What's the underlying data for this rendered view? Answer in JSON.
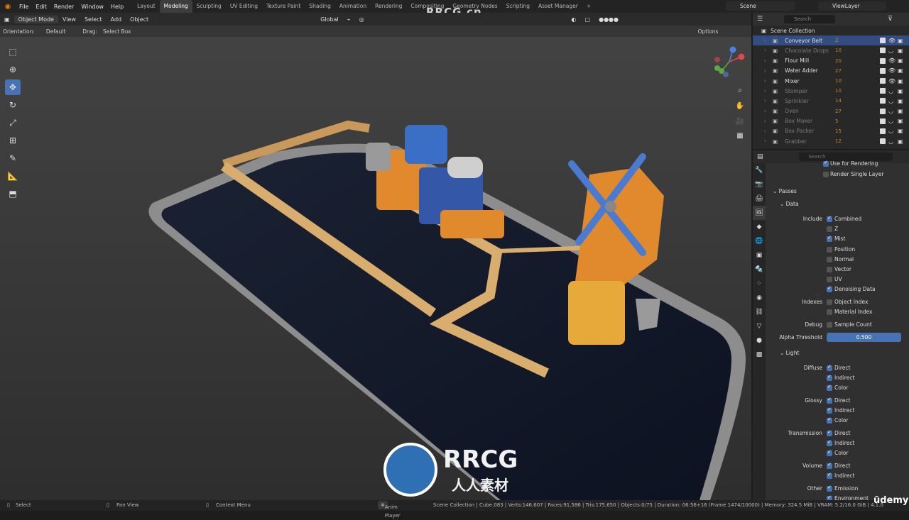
{
  "app": {
    "menus": [
      "File",
      "Edit",
      "Render",
      "Window",
      "Help"
    ],
    "workspaces": [
      "Layout",
      "Modeling",
      "Sculpting",
      "UV Editing",
      "Texture Paint",
      "Shading",
      "Animation",
      "Rendering",
      "Compositing",
      "Geometry Nodes",
      "Scripting",
      "Asset Manager"
    ],
    "active_workspace": "Modeling",
    "scene": "Scene",
    "view_layer": "ViewLayer",
    "watermark": "RRCG.cn"
  },
  "viewport_header": {
    "mode": "Object Mode",
    "menus": [
      "View",
      "Select",
      "Add",
      "Object"
    ],
    "transform": "Global",
    "orientation_label": "Orientation:",
    "orientation_value": "Default",
    "drag_label": "Drag:",
    "drag_value": "Select Box",
    "options": "Options"
  },
  "outliner": {
    "search_placeholder": "Search",
    "root": "Scene Collection",
    "items": [
      {
        "name": "Conveyor Belt",
        "badge": "2",
        "selected": true,
        "dim": false,
        "visible": true
      },
      {
        "name": "Chocolate Drops",
        "badge": "10",
        "selected": false,
        "dim": true,
        "visible": false
      },
      {
        "name": "Flour Mill",
        "badge": "20",
        "selected": false,
        "dim": false,
        "visible": true
      },
      {
        "name": "Water Adder",
        "badge": "27",
        "selected": false,
        "dim": false,
        "visible": true
      },
      {
        "name": "Mixer",
        "badge": "10",
        "selected": false,
        "dim": false,
        "visible": true
      },
      {
        "name": "Stomper",
        "badge": "10",
        "selected": false,
        "dim": true,
        "visible": false
      },
      {
        "name": "Sprinkler",
        "badge": "14",
        "selected": false,
        "dim": true,
        "visible": false
      },
      {
        "name": "Oven",
        "badge": "27",
        "selected": false,
        "dim": true,
        "visible": false
      },
      {
        "name": "Box Maker",
        "badge": "5",
        "selected": false,
        "dim": true,
        "visible": false
      },
      {
        "name": "Box Packer",
        "badge": "15",
        "selected": false,
        "dim": true,
        "visible": false
      },
      {
        "name": "Grabber",
        "badge": "12",
        "selected": false,
        "dim": true,
        "visible": false
      }
    ]
  },
  "properties": {
    "search_placeholder": "Search",
    "use_for_rendering": "Use for Rendering",
    "render_single_layer": "Render Single Layer",
    "passes": "Passes",
    "data": "Data",
    "include_label": "Include",
    "include": [
      {
        "label": "Combined",
        "on": true
      },
      {
        "label": "Z",
        "on": false
      },
      {
        "label": "Mist",
        "on": true
      },
      {
        "label": "Position",
        "on": false
      },
      {
        "label": "Normal",
        "on": false
      },
      {
        "label": "Vector",
        "on": false
      },
      {
        "label": "UV",
        "on": false
      },
      {
        "label": "Denoising Data",
        "on": true
      }
    ],
    "indexes_label": "Indexes",
    "indexes": [
      {
        "label": "Object Index",
        "on": false
      },
      {
        "label": "Material Index",
        "on": false
      }
    ],
    "debug_label": "Debug",
    "sample_count": "Sample Count",
    "alpha_threshold_label": "Alpha Threshold",
    "alpha_threshold": "0.500",
    "light": "Light",
    "diffuse_label": "Diffuse",
    "glossy_label": "Glossy",
    "transmission_label": "Transmission",
    "volume_label": "Volume",
    "other_label": "Other",
    "direct": "Direct",
    "indirect": "Indirect",
    "color": "Color",
    "emission": "Emission",
    "environment": "Environment"
  },
  "statusbar": {
    "select": "Select",
    "pan_view": "Pan View",
    "context_menu": "Context Menu",
    "anim_player": "Anim Player",
    "stats": "Scene Collection | Cube.083 | Verts:146,607 | Faces:91,586 | Tris:175,650 | Objects:0/75 | Duration: 06:56+16 (Frame 1474/10000) | Memory: 324.5 MiB | VRAM: 5.2/16.0 GiB | 4.1.0"
  },
  "brand": {
    "logo_text": "RRCG",
    "logo_sub": "人人素材",
    "udemy": "ūdemy"
  },
  "colors": {
    "accent": "#4772b3",
    "selection": "#334d80",
    "object_orange": "#c8842e"
  }
}
